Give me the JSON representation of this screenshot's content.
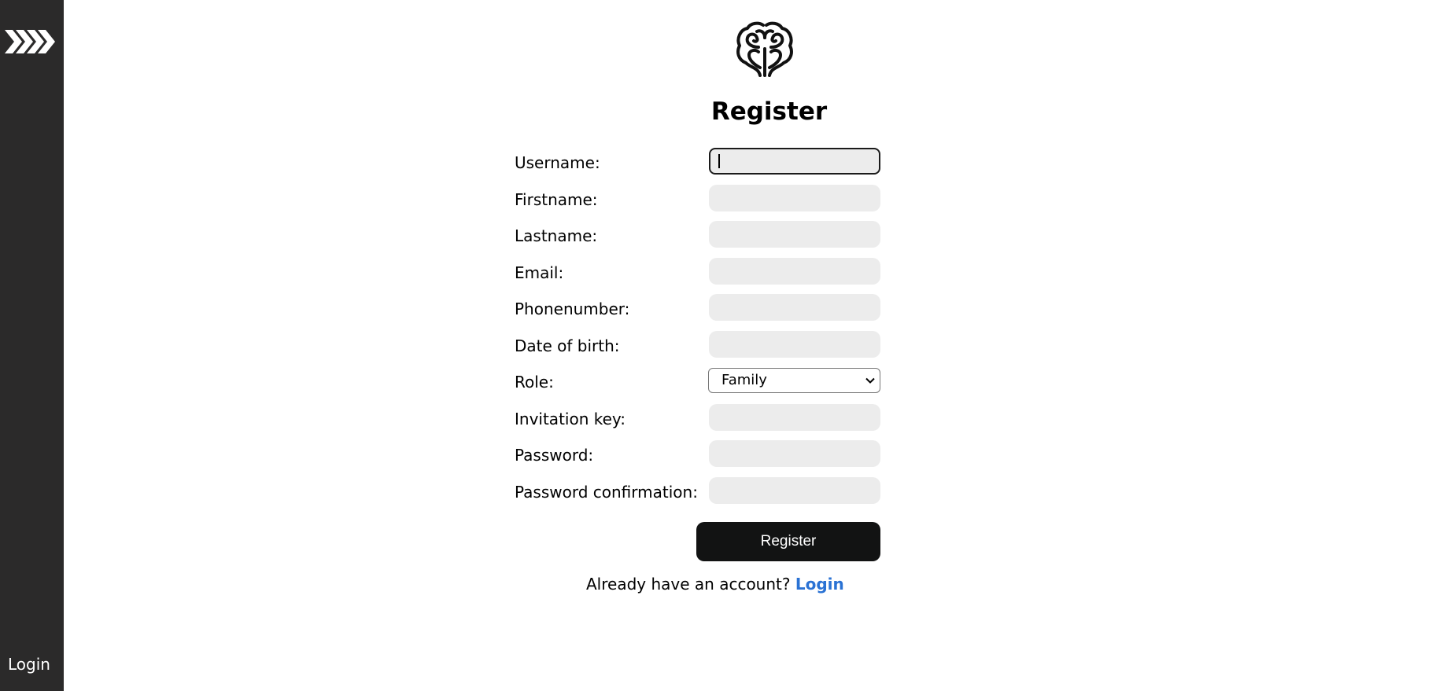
{
  "sidebar": {
    "expand_icon": "chevrons-right-icon",
    "login_label": "Login"
  },
  "logo_icon": "brain-icon",
  "title": "Register",
  "form": {
    "fields": [
      {
        "label": "Username:",
        "value": ""
      },
      {
        "label": "Firstname:",
        "value": ""
      },
      {
        "label": "Lastname:",
        "value": ""
      },
      {
        "label": "Email:",
        "value": ""
      },
      {
        "label": "Phonenumber:",
        "value": ""
      },
      {
        "label": "Date of birth:",
        "value": ""
      },
      {
        "label": "Role:",
        "value": "Family"
      },
      {
        "label": "Invitation key:",
        "value": ""
      },
      {
        "label": "Password:",
        "value": ""
      },
      {
        "label": "Password confirmation:",
        "value": ""
      }
    ],
    "register_label": "Register"
  },
  "footer": {
    "prompt": "Already have an account?",
    "login_link": "Login"
  },
  "colors": {
    "sidebar_bg": "#2b2a2a",
    "input_bg": "#ececec",
    "button_bg": "#121313",
    "link": "#2a72d4"
  }
}
